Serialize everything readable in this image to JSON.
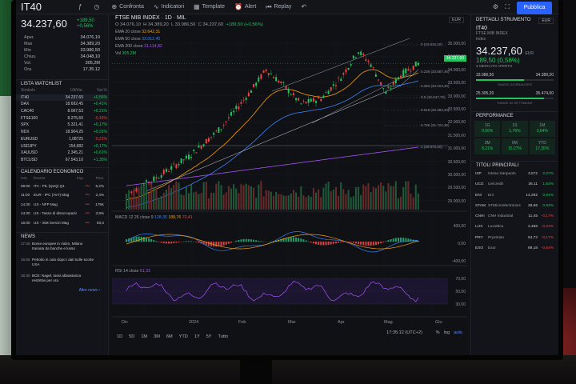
{
  "topbar": {
    "symbol": "IT40",
    "buttons": [
      {
        "icon": "fx",
        "label": ""
      },
      {
        "icon": "clock",
        "label": ""
      },
      {
        "icon": "compare",
        "label": "Confronta"
      },
      {
        "icon": "indicators",
        "label": "Indicatori"
      },
      {
        "icon": "template",
        "label": "Template"
      },
      {
        "icon": "alert",
        "label": "Alert"
      },
      {
        "icon": "replay",
        "label": "Replay"
      }
    ],
    "publish_label": "Pubblica"
  },
  "quote_panel": {
    "price": "34.237,60",
    "change": "+189,50",
    "change_pct": "+0,56%",
    "stats": [
      {
        "label": "Aper.",
        "value": "34.076,10"
      },
      {
        "label": "Max",
        "value": "34.389,20"
      },
      {
        "label": "Min",
        "value": "33.986,50"
      },
      {
        "label": "Chius.",
        "value": "34.048,10"
      },
      {
        "label": "Vol.",
        "value": "305,2M"
      },
      {
        "label": "Ora",
        "value": "17.35.12"
      }
    ]
  },
  "watchlist": {
    "title": "LISTA WATCHLIST",
    "columns": [
      "Simbolo",
      "Ult/Var.",
      "Var.%"
    ],
    "rows": [
      {
        "symbol": "IT40",
        "last": "34.237,60",
        "chg": "+0,56%",
        "dir": "pos"
      },
      {
        "symbol": "DAX",
        "last": "18.692,45",
        "chg": "+0,41%",
        "dir": "pos"
      },
      {
        "symbol": "CAC40",
        "last": "8.067,53",
        "chg": "+0,21%",
        "dir": "pos"
      },
      {
        "symbol": "FTSE100",
        "last": "8.275,60",
        "chg": "-0,15%",
        "dir": "neg"
      },
      {
        "symbol": "SPX",
        "last": "5.321,41",
        "chg": "+0,17%",
        "dir": "pos"
      },
      {
        "symbol": "NDX",
        "last": "18.904,25",
        "chg": "+0,31%",
        "dir": "pos"
      },
      {
        "symbol": "EURUSD",
        "last": "1,08725",
        "chg": "-0,21%",
        "dir": "neg"
      },
      {
        "symbol": "USDJPY",
        "last": "154,682",
        "chg": "+0,17%",
        "dir": "pos"
      },
      {
        "symbol": "XAUUSD",
        "last": "2.345,21",
        "chg": "+0,61%",
        "dir": "pos"
      },
      {
        "symbol": "BTCUSD",
        "last": "67.543,10",
        "chg": "+1,35%",
        "dir": "pos"
      }
    ]
  },
  "calendar": {
    "title": "CALENDARIO ECONOMICO",
    "columns": [
      "Ora",
      "Evento",
      "Imp.",
      "Prev."
    ],
    "rows": [
      {
        "time": "09:00",
        "event": "ITA - PIL (QoQ) Q1",
        "imp": "●●●",
        "prev": "6,2%"
      },
      {
        "time": "11:00",
        "event": "EUR - IPC (YoY) Mag",
        "imp": "●●●",
        "prev": "2,4%"
      },
      {
        "time": "14:30",
        "event": "US - NFP Mag",
        "imp": "●●●",
        "prev": "175K"
      },
      {
        "time": "14:30",
        "event": "US - Tasso di disoccupazione",
        "imp": "●●●",
        "prev": "3,9%"
      },
      {
        "time": "16:00",
        "event": "US - ISM Servizi Mag",
        "imp": "●●●",
        "prev": "50,0"
      }
    ]
  },
  "news": {
    "title": "NEWS",
    "items": [
      {
        "time": "17:25",
        "text": "Borse europee in rialzo, Milano trainata da banche e lusso"
      },
      {
        "time": "16:55",
        "text": "Petrolio in calo dopo i dati sulle scorte USA"
      },
      {
        "time": "16:30",
        "text": "BCE: Nagel, tassi abbastanza restrittivi per ora"
      }
    ],
    "more_label": "Altre news ›"
  },
  "chart": {
    "title": "FTSE MIB INDEX · 1D · MIL",
    "currency_sel": "EUR",
    "ohlc": {
      "o": "34.076,10",
      "h": "34.389,20",
      "l": "33.986,50",
      "c": "34.237,60",
      "chg": "+189,50 (+0,56%)"
    },
    "ema": [
      {
        "label": "EMA 20 close",
        "value": "33.642,31",
        "color": "#f59e0b"
      },
      {
        "label": "EMA 50 close",
        "value": "33.012,45",
        "color": "#3b82f6"
      },
      {
        "label": "EMA 200 close",
        "value": "31.114,82",
        "color": "#a855f7"
      },
      {
        "label": "Vol",
        "value": "305,2M",
        "color": "#22c55e"
      }
    ],
    "price_axis": [
      "35.000,00",
      "34.500,00",
      "34.000,00",
      "33.500,00",
      "33.000,00",
      "32.500,00",
      "32.000,00",
      "31.500,00",
      "31.000,00",
      "30.500,00",
      "30.000,00",
      "29.500,00",
      "29.000,00"
    ],
    "current_price_tag": "34.237,60",
    "fib_levels": [
      "0 (34.815,20)",
      "0.236 (33.887,45)",
      "0.382 (33.313,20)",
      "0.5 (32.847,70)",
      "0.618 (32.383,20)",
      "0.786 (31.724,35)",
      "1 (30.875,40)"
    ],
    "macd_label": "MACD 12 26 close 9",
    "macd_values": [
      "128,35",
      "188,76",
      "70,41"
    ],
    "macd_axis": [
      "400,00",
      "0,00",
      "-400,00"
    ],
    "rsi_label": "RSI 14 close",
    "rsi_value": "61,33",
    "rsi_axis": [
      "70,00",
      "50,00",
      "30,00"
    ],
    "xaxis": [
      "Dic",
      "2024",
      "Feb",
      "Mar",
      "Apr",
      "Mag",
      "Giu"
    ],
    "timeframes": [
      "1D",
      "5D",
      "1M",
      "3M",
      "6M",
      "YTD",
      "1Y",
      "5Y",
      "Tutto"
    ],
    "clock": "17:35:12 (UTC+2)",
    "scale_opts": [
      "%",
      "log",
      "auto"
    ]
  },
  "details": {
    "title": "DETTAGLI STRUMENTO",
    "currency": "EUR",
    "symbol": "IT40",
    "name": "FTSE MIB INDEX",
    "name_suffix": "Index",
    "price": "34.237,60",
    "price_unit": "EUR",
    "change": "189,50 (0,56%)",
    "market_state": "● MERCATO APERTO",
    "day_range": {
      "low": "33.986,50",
      "high": "34.389,20",
      "label": "RANGE GIORNALIERO",
      "fill": 0.62
    },
    "week52_range": {
      "low": "25.305,20",
      "high": "35.474,00",
      "label": "RANGE 52 SETTIMANE",
      "fill": 0.88
    },
    "performance_title": "PERFORMANCE",
    "performance": [
      {
        "k": "1G",
        "v": "0,56%"
      },
      {
        "k": "1S",
        "v": "1,76%"
      },
      {
        "k": "1M",
        "v": "3,64%"
      },
      {
        "k": "3M",
        "v": "8,21%"
      },
      {
        "k": "6M",
        "v": "15,27%"
      },
      {
        "k": "YTD",
        "v": "17,35%"
      }
    ],
    "top_title": "TITOLI PRINCIPALI",
    "top": [
      {
        "sym": "ISP",
        "name": "Intesa Sanpaolo",
        "price": "3,572",
        "chg": "2,07%",
        "dir": "pos"
      },
      {
        "sym": "UCG",
        "name": "Unicredit",
        "price": "36,11",
        "chg": "1,63%",
        "dir": "pos"
      },
      {
        "sym": "ENI",
        "name": "Eni",
        "price": "14,292",
        "chg": "0,91%",
        "dir": "pos"
      },
      {
        "sym": "STAM",
        "name": "STMicroelectronics",
        "price": "28,66",
        "chg": "0,84%",
        "dir": "pos"
      },
      {
        "sym": "CNHI",
        "name": "CNH Industrial",
        "price": "11,45",
        "chg": "-0,17%",
        "dir": "neg"
      },
      {
        "sym": "LUX",
        "name": "Luxottica",
        "price": "2,456",
        "chg": "-0,24%",
        "dir": "neg"
      },
      {
        "sym": "PRY",
        "name": "Prysmian",
        "price": "54,72",
        "chg": "-0,17%",
        "dir": "neg"
      },
      {
        "sym": "EXO",
        "name": "Exor",
        "price": "89,18",
        "chg": "-0,64%",
        "dir": "neg"
      }
    ]
  },
  "colors": {
    "up": "#22c55e",
    "down": "#ef4444",
    "accent": "#2962ff",
    "bg": "#0f1115"
  }
}
